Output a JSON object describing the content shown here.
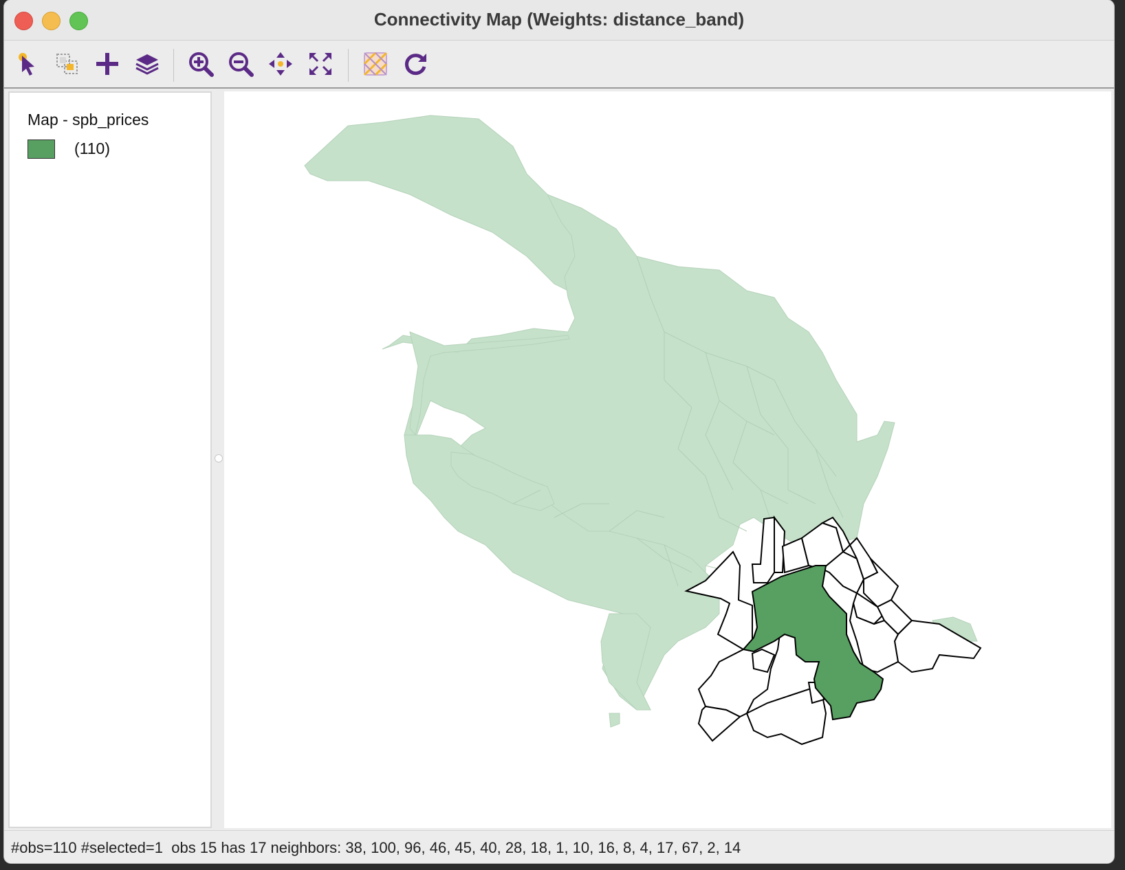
{
  "window": {
    "title": "Connectivity Map (Weights: distance_band)"
  },
  "toolbar": {
    "tools": [
      {
        "name": "select-tool",
        "icon": "pointer-select-icon"
      },
      {
        "name": "selection-shape-tool",
        "icon": "selection-shape-icon"
      },
      {
        "name": "add-layer-tool",
        "icon": "plus-icon"
      },
      {
        "name": "layers-tool",
        "icon": "layers-icon"
      },
      {
        "name": "zoom-in-tool",
        "icon": "zoom-in-icon"
      },
      {
        "name": "zoom-out-icon",
        "icon": "zoom-out-icon"
      },
      {
        "name": "pan-tool",
        "icon": "pan-arrows-icon"
      },
      {
        "name": "fit-extent-tool",
        "icon": "full-extent-icon"
      },
      {
        "name": "basemap-tool",
        "icon": "basemap-icon"
      },
      {
        "name": "refresh-tool",
        "icon": "refresh-icon"
      }
    ],
    "accent_color": "#5b2a86",
    "highlight_color": "#f3b62b"
  },
  "legend": {
    "title": "Map - spb_prices",
    "items": [
      {
        "label": "(110)",
        "color": "#58a062"
      }
    ]
  },
  "map": {
    "base_fill": "#c6e1ca",
    "selected_fill": "#58a062",
    "neighbor_fill": "#ffffff",
    "outline_color": "#000000"
  },
  "status": {
    "text": "#obs=110 #selected=1  obs 15 has 17 neighbors: 38, 100, 96, 46, 45, 40, 28, 18, 1, 10, 16, 8, 4, 17, 67, 2, 14"
  }
}
